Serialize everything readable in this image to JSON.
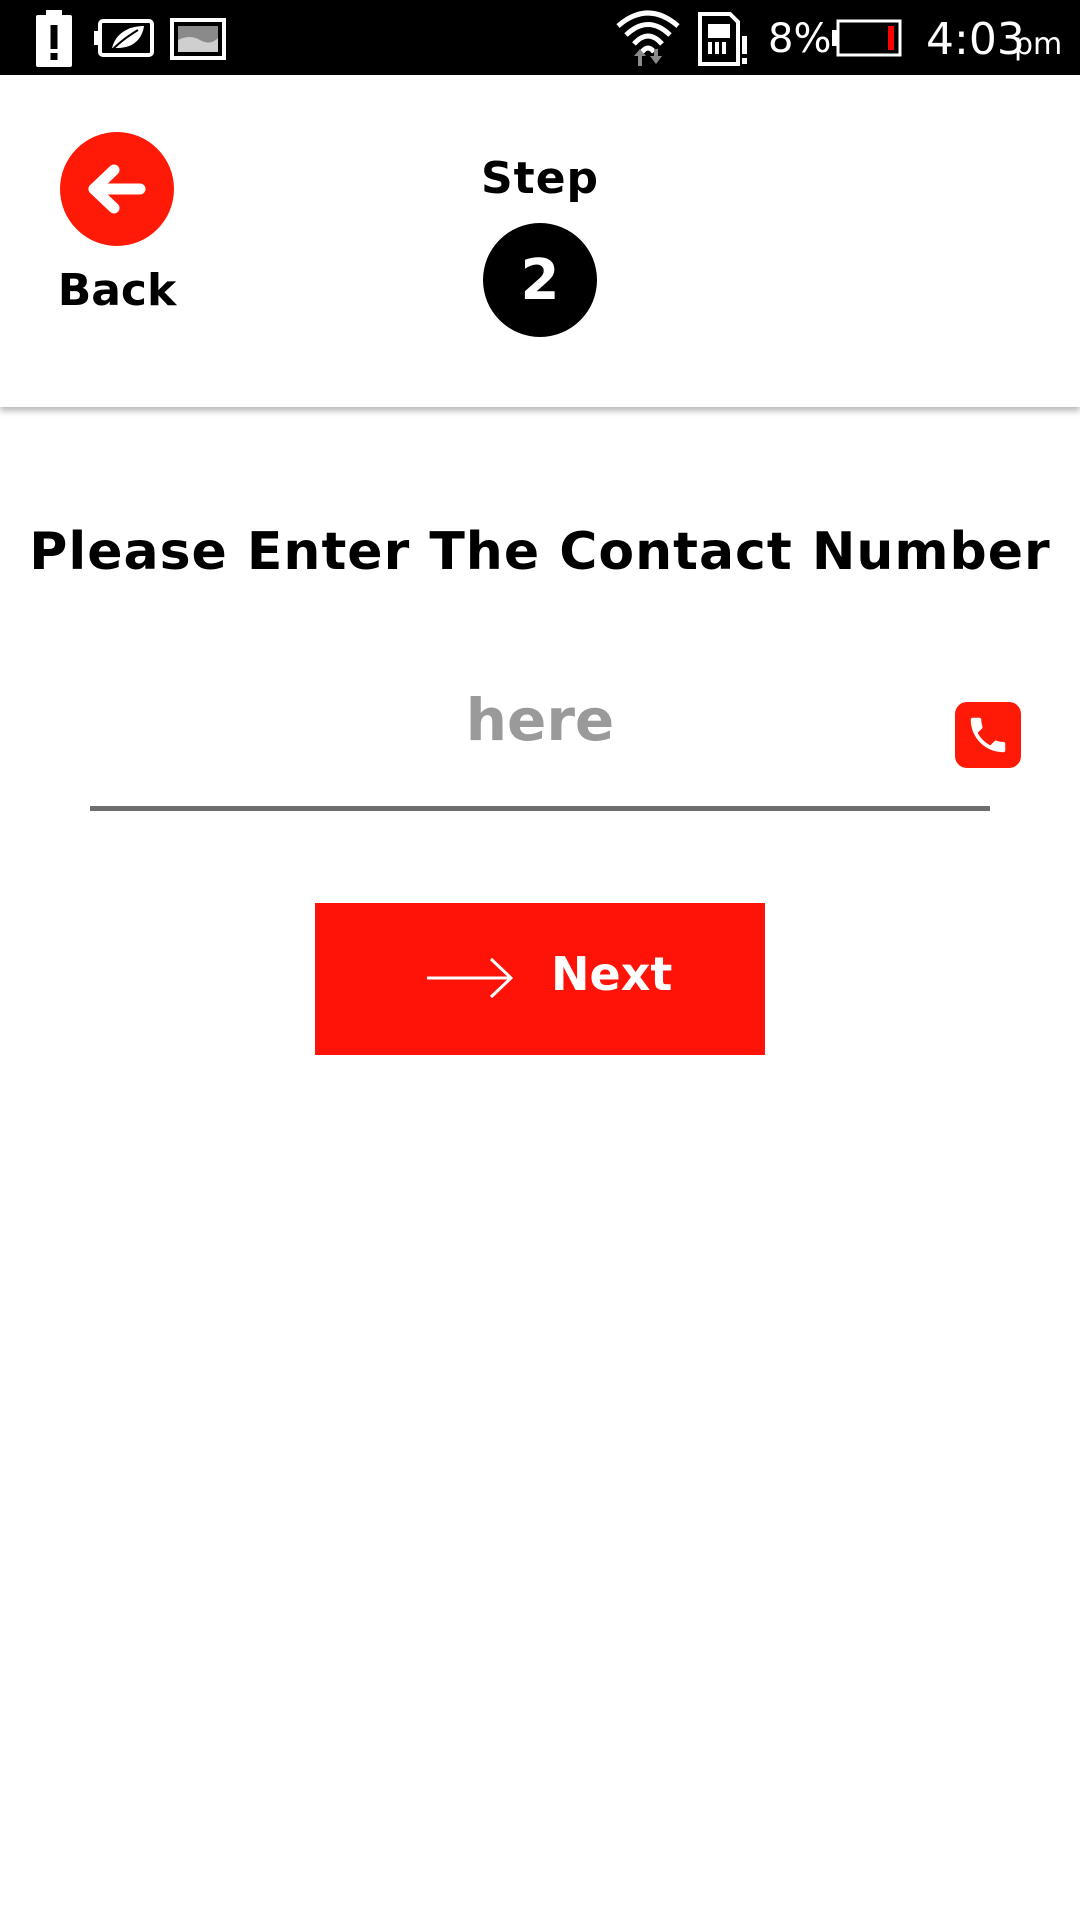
{
  "status_bar": {
    "battery_percent": "8%",
    "time": "4:03",
    "ampm": "pm",
    "icons": [
      "battery-alert-icon",
      "battery-saver-icon",
      "gallery-icon",
      "wifi-icon",
      "sim-alert-icon",
      "battery-icon"
    ],
    "battery_level_color": "#ff0000"
  },
  "header": {
    "back_label": "Back",
    "step_label": "Step",
    "step_number": "2"
  },
  "form": {
    "prompt": "Please Enter The Contact Number",
    "phone_placeholder": "here",
    "phone_value": "",
    "next_label": "Next"
  },
  "colors": {
    "accent": "#ff1207",
    "badge": "#000000",
    "underline": "#6e6e6e",
    "placeholder": "#9a9a9a"
  }
}
